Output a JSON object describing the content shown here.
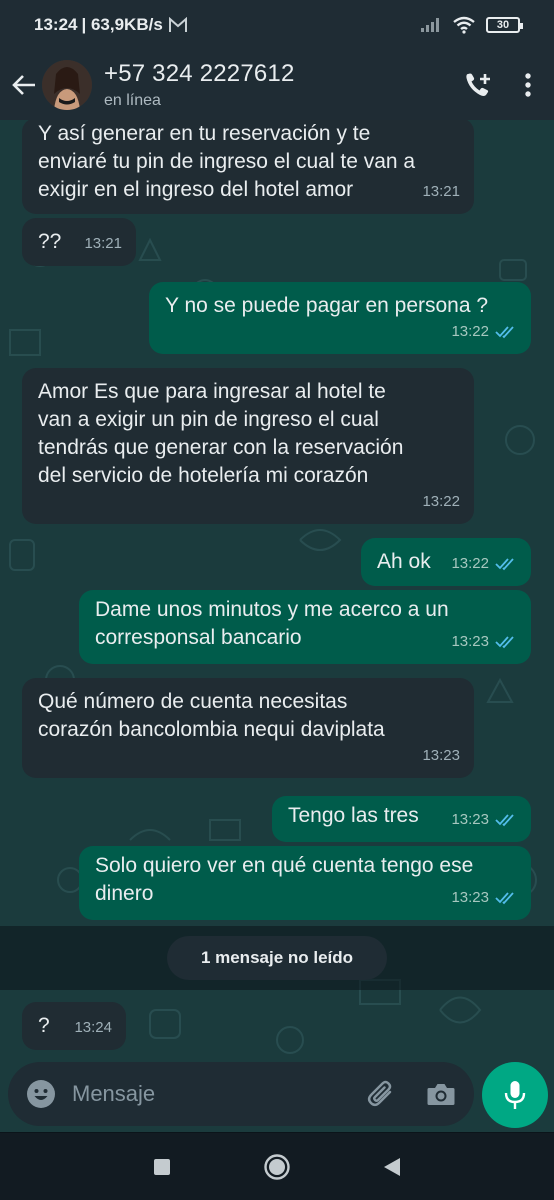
{
  "status_bar": {
    "time": "13:24",
    "speed": "| 63,9KB/s",
    "battery": "30"
  },
  "header": {
    "contact_name": "+57 324 2227612",
    "contact_status": "en línea"
  },
  "messages": [
    {
      "text": "Y así generar en tu reservación y te\nenviaré tu pin de ingreso el cual te van a\nexigir en el ingreso del hotel amor",
      "time": "13:21",
      "direction": "in"
    },
    {
      "text": "??",
      "time": "13:21",
      "direction": "in"
    },
    {
      "text": "Y no se puede pagar en persona ?",
      "time": "13:22",
      "direction": "out",
      "read": true
    },
    {
      "text": "Amor Es que para ingresar al hotel te\nvan a exigir un pin de ingreso el cual\ntendrás que generar con la reservación\ndel servicio de hotelería mi corazón",
      "time": "13:22",
      "direction": "in"
    },
    {
      "text": "Ah ok",
      "time": "13:22",
      "direction": "out",
      "read": true
    },
    {
      "text": "Dame unos minutos y me acerco a un\ncorresponsal bancario",
      "time": "13:23",
      "direction": "out",
      "read": true
    },
    {
      "text": "Qué número de cuenta necesitas\ncorazón bancolombia nequi daviplata",
      "time": "13:23",
      "direction": "in"
    },
    {
      "text": "Tengo las tres",
      "time": "13:23",
      "direction": "out",
      "read": true
    },
    {
      "text": "Solo quiero ver en qué cuenta tengo ese\ndinero",
      "time": "13:23",
      "direction": "out",
      "read": true
    },
    {
      "text": "?",
      "time": "13:24",
      "direction": "in"
    }
  ],
  "unread_label": "1 mensaje no leído",
  "composer": {
    "placeholder": "Mensaje"
  },
  "colors": {
    "incoming_bubble": "#202c33",
    "outgoing_bubble": "#005c4b",
    "accent": "#00a884",
    "read_ticks": "#53bdeb"
  },
  "icons": [
    "whatsapp-logo-icon",
    "signal-icon",
    "wifi-icon",
    "battery-icon",
    "back-arrow-icon",
    "add-call-icon",
    "more-vert-icon",
    "double-check-icon",
    "emoji-icon",
    "attach-icon",
    "camera-icon",
    "mic-icon",
    "nav-back-icon",
    "nav-home-icon",
    "nav-recents-icon"
  ]
}
